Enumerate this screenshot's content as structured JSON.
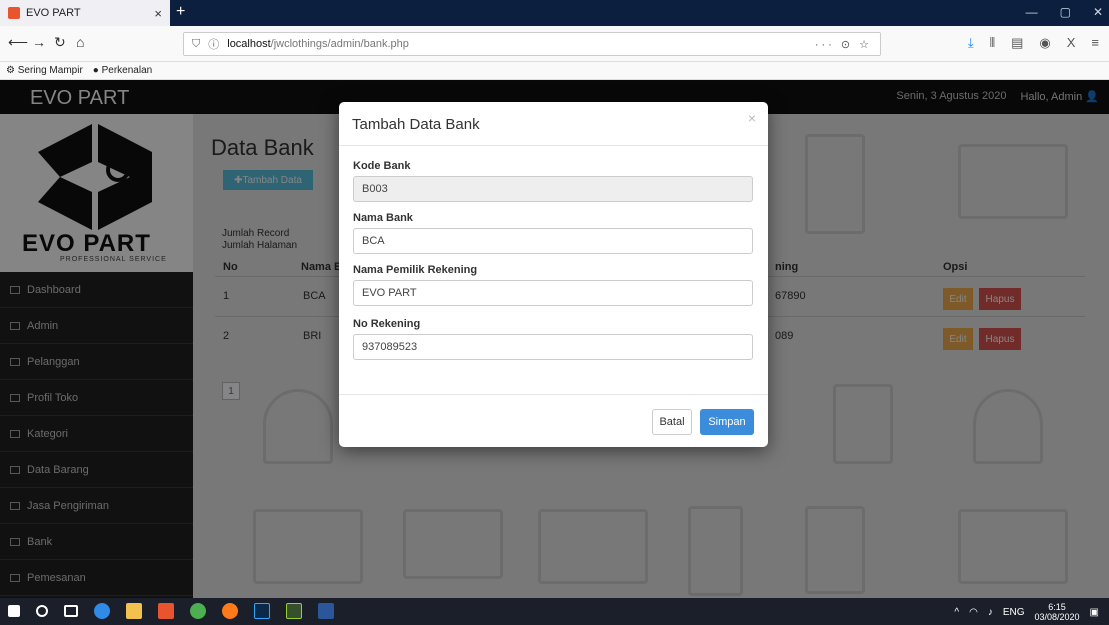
{
  "browser": {
    "tab_title": "EVO PART",
    "tab_close": "×",
    "new_tab": "+",
    "url_host": "localhost",
    "url_path": "/jwclothings/admin/bank.php",
    "url_actions": "··· ⊙ ☆",
    "bookmarks": [
      "Sering Mampir",
      "Perkenalan"
    ]
  },
  "header": {
    "brand": "EVO PART",
    "date": "Senin, 3 Agustus 2020",
    "greeting": "Hallo, Admin"
  },
  "logo": {
    "text": "EVO PART",
    "sub": "PROFESSIONAL SERVICE"
  },
  "sidebar": {
    "items": [
      {
        "label": "Dashboard"
      },
      {
        "label": "Admin"
      },
      {
        "label": "Pelanggan"
      },
      {
        "label": "Profil Toko"
      },
      {
        "label": "Kategori"
      },
      {
        "label": "Data Barang"
      },
      {
        "label": "Jasa Pengiriman"
      },
      {
        "label": "Bank"
      },
      {
        "label": "Pemesanan"
      }
    ]
  },
  "main": {
    "title": "Data Bank",
    "add_button": "Tambah Data",
    "jumlah_record": "Jumlah Record",
    "jumlah_halaman": "Jumlah Halaman",
    "columns": {
      "no": "No",
      "nama": "Nama B",
      "rekening": "ning",
      "opsi": "Opsi"
    },
    "rows": [
      {
        "no": "1",
        "nama": "BCA",
        "rekening": "67890"
      },
      {
        "no": "2",
        "nama": "BRI",
        "rekening": "089"
      }
    ],
    "edit_label": "Edit",
    "hapus_label": "Hapus",
    "page": "1"
  },
  "modal": {
    "title": "Tambah Data Bank",
    "close": "×",
    "fields": {
      "kode_label": "Kode Bank",
      "kode_value": "B003",
      "nama_label": "Nama Bank",
      "nama_value": "BCA",
      "pemilik_label": "Nama Pemilik Rekening",
      "pemilik_value": "EVO PART",
      "rekening_label": "No Rekening",
      "rekening_value": "937089523"
    },
    "cancel": "Batal",
    "save": "Simpan"
  },
  "taskbar": {
    "tray_lang": "ENG",
    "time": "6:15",
    "date": "03/08/2020"
  },
  "colors": {
    "primary": "#3b8ddc",
    "info": "#5bc0de",
    "warning": "#f0ad4e",
    "danger": "#d9534f",
    "header": "#111111"
  }
}
